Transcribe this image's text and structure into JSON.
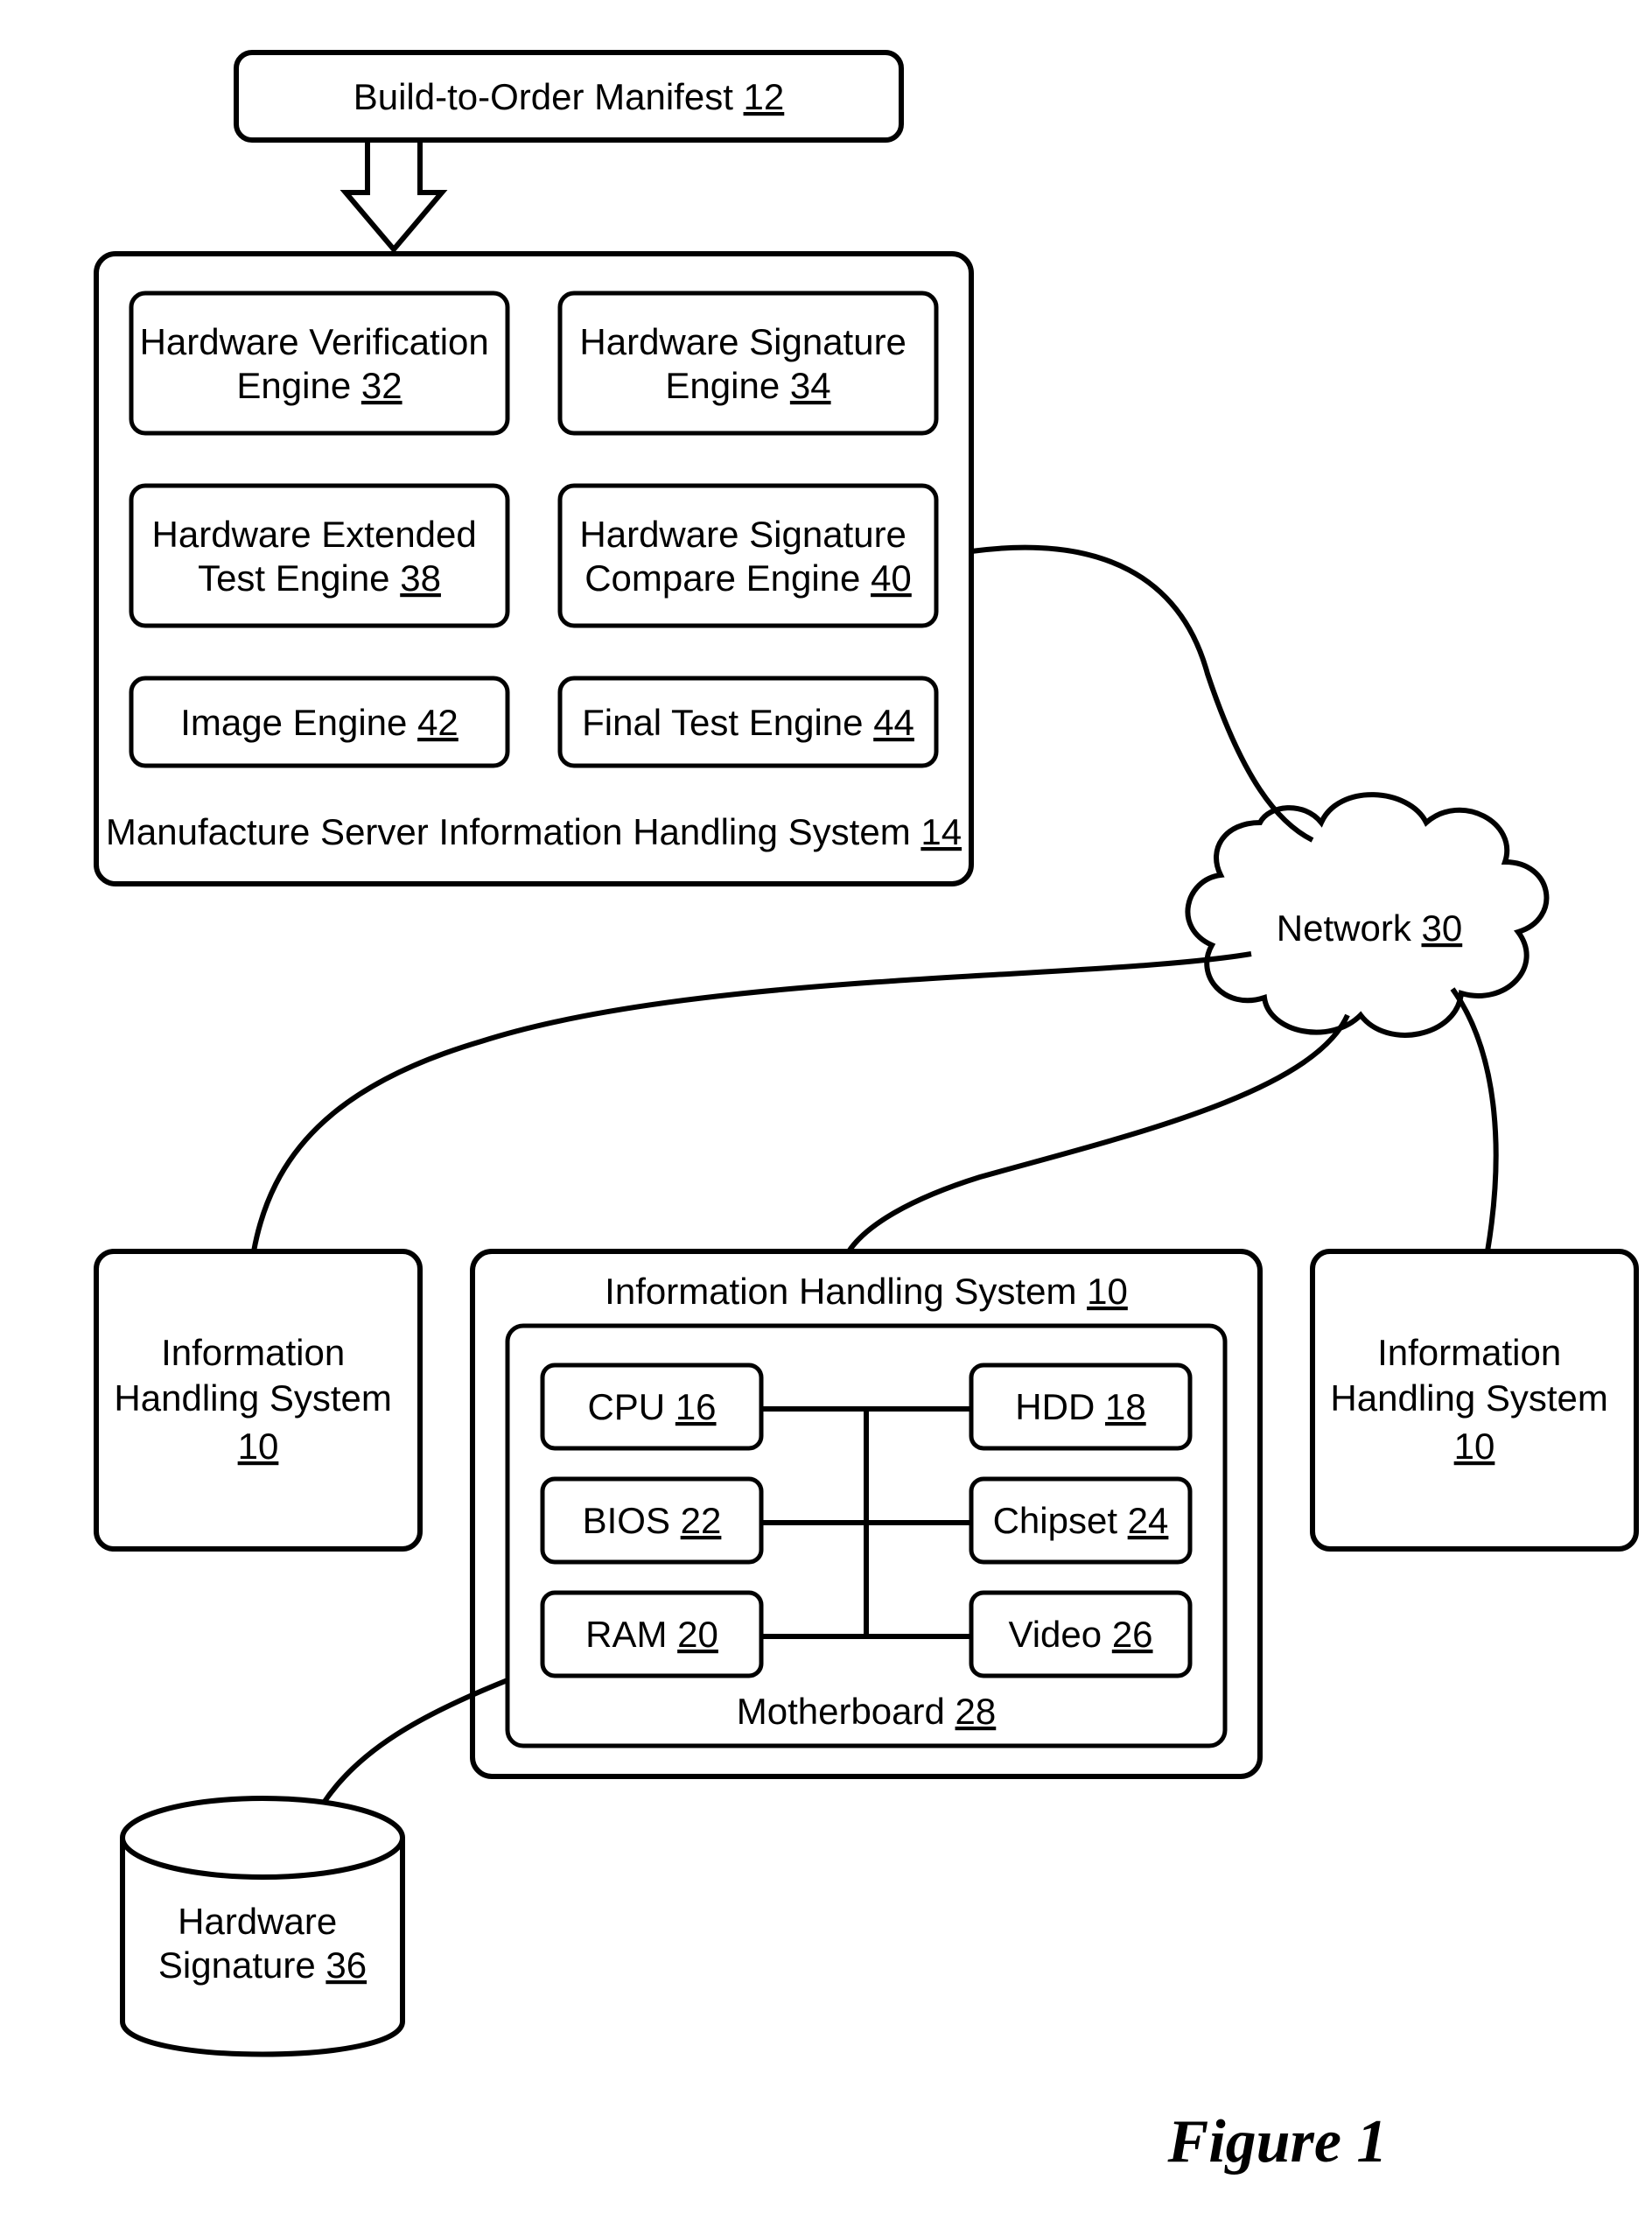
{
  "figure_caption": "Figure 1",
  "manifest": {
    "label": "Build-to-Order Manifest",
    "ref": "12"
  },
  "server": {
    "label": "Manufacture Server Information Handling System",
    "ref": "14",
    "engines": [
      {
        "l1": "Hardware Verification",
        "l2": "Engine",
        "ref": "32"
      },
      {
        "l1": "Hardware Signature",
        "l2": "Engine",
        "ref": "34"
      },
      {
        "l1": "Hardware Extended",
        "l2": "Test Engine",
        "ref": "38"
      },
      {
        "l1": "Hardware Signature",
        "l2": "Compare Engine",
        "ref": "40"
      },
      {
        "l1": "Image Engine",
        "l2": "",
        "ref": "42"
      },
      {
        "l1": "Final Test Engine",
        "l2": "",
        "ref": "44"
      }
    ]
  },
  "network": {
    "label": "Network",
    "ref": "30"
  },
  "ihs_left": {
    "l1": "Information",
    "l2": "Handling System",
    "ref": "10"
  },
  "ihs_right": {
    "l1": "Information",
    "l2": "Handling System",
    "ref": "10"
  },
  "ihs_center": {
    "label": "Information Handling System",
    "ref": "10",
    "mb": {
      "label": "Motherboard",
      "ref": "28"
    },
    "comps": [
      {
        "label": "CPU",
        "ref": "16"
      },
      {
        "label": "HDD",
        "ref": "18"
      },
      {
        "label": "BIOS",
        "ref": "22"
      },
      {
        "label": "Chipset",
        "ref": "24"
      },
      {
        "label": "RAM",
        "ref": "20"
      },
      {
        "label": "Video",
        "ref": "26"
      }
    ]
  },
  "db": {
    "l1": "Hardware",
    "l2": "Signature",
    "ref": "36"
  }
}
